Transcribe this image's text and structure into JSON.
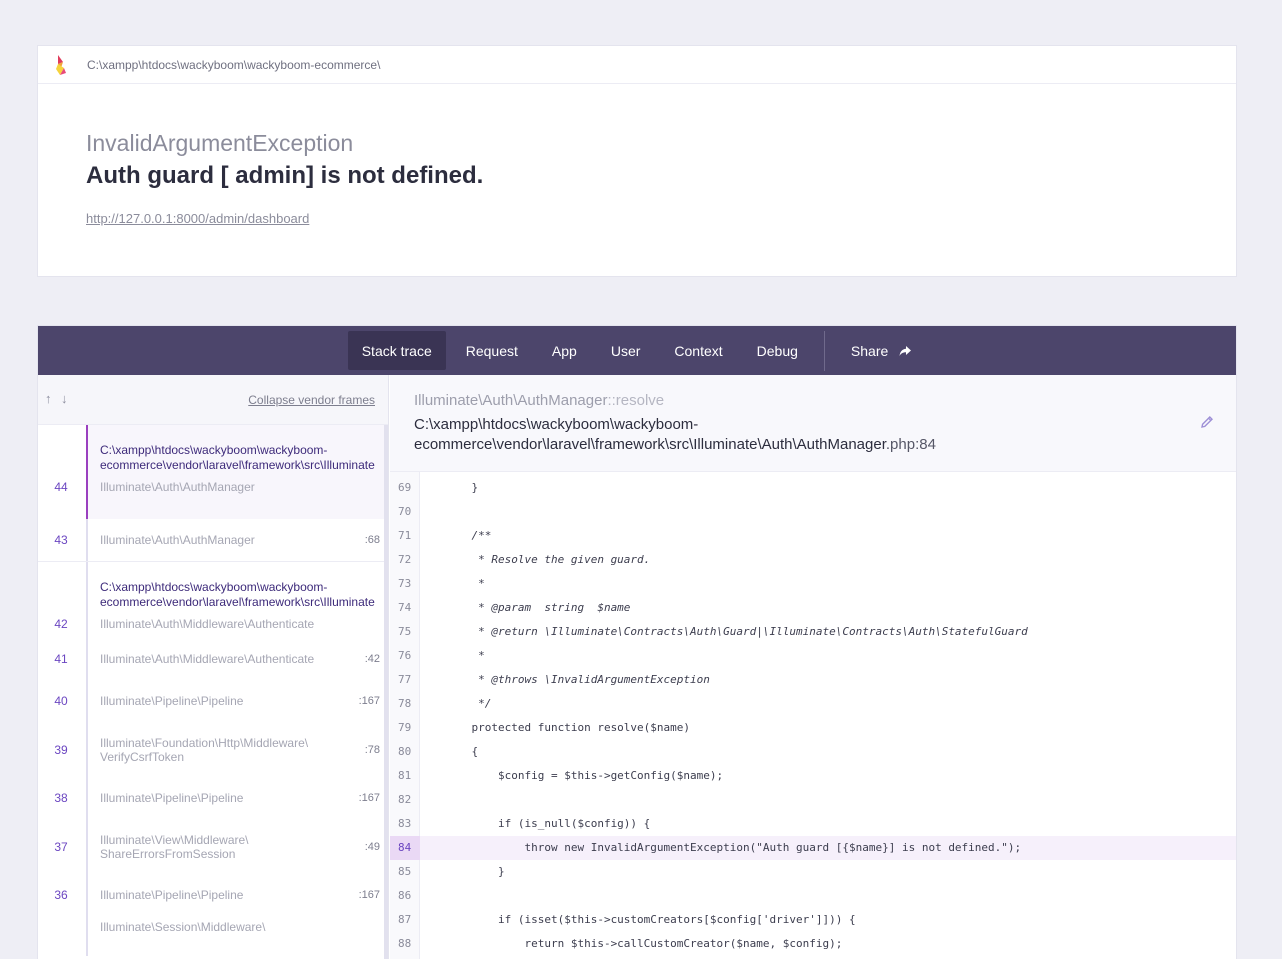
{
  "header": {
    "path": "C:\\xampp\\htdocs\\wackyboom\\wackyboom-ecommerce\\",
    "exception_class": "InvalidArgumentException",
    "exception_message": "Auth guard [ admin] is not defined.",
    "url": "http://127.0.0.1:8000/admin/dashboard"
  },
  "tabs": {
    "stack_trace": "Stack trace",
    "request": "Request",
    "app": "App",
    "user": "User",
    "context": "Context",
    "debug": "Debug",
    "share": "Share"
  },
  "stack": {
    "arrow_up": "↑",
    "arrow_down": "↓",
    "collapse_label": "Collapse vendor frames",
    "groups": [
      {
        "file": "C:\\xampp\\htdocs\\wackyboom\\wackyboom-ecommerce\\vendor\\laravel\\framework\\src\\Illuminate\\Auth\\AuthManager.php",
        "file_line1": "C:\\xampp\\htdocs\\wackyboom\\wackyboom-",
        "file_line2": "ecommerce\\vendor\\laravel\\framework\\src\\Illuminate",
        "frames": [
          {
            "num": "44",
            "class": "Illuminate\\Auth\\AuthManager",
            "line": ""
          },
          {
            "num": "43",
            "class": "Illuminate\\Auth\\AuthManager",
            "line": ":68"
          }
        ]
      },
      {
        "file_line1": "C:\\xampp\\htdocs\\wackyboom\\wackyboom-",
        "file_line2": "ecommerce\\vendor\\laravel\\framework\\src\\Illuminate",
        "frames": [
          {
            "num": "42",
            "class": "Illuminate\\Auth\\Middleware\\Authenticate",
            "line": ""
          },
          {
            "num": "41",
            "class": "Illuminate\\Auth\\Middleware\\Authenticate",
            "line": ":42"
          },
          {
            "num": "40",
            "class": "Illuminate\\Pipeline\\Pipeline",
            "line": ":167"
          },
          {
            "num": "39",
            "class_line1": "Illuminate\\Foundation\\Http\\Middleware\\",
            "class_line2": "VerifyCsrfToken",
            "line": ":78"
          },
          {
            "num": "38",
            "class": "Illuminate\\Pipeline\\Pipeline",
            "line": ":167"
          },
          {
            "num": "37",
            "class_line1": "Illuminate\\View\\Middleware\\",
            "class_line2": "ShareErrorsFromSession",
            "line": ":49"
          },
          {
            "num": "36",
            "class": "Illuminate\\Pipeline\\Pipeline",
            "line": ":167"
          },
          {
            "num": "35",
            "class_line1": "Illuminate\\Session\\Middleware\\",
            "class_line2": "",
            "line": ""
          }
        ]
      }
    ]
  },
  "code": {
    "class_name": "Illuminate\\Auth\\AuthManager",
    "method": "::resolve",
    "file_line1": "C:\\xampp\\htdocs\\wackyboom\\wackyboom-",
    "file_line2": "ecommerce\\vendor\\laravel\\framework\\src\\Illuminate\\Auth\\AuthManager",
    "file_suffix": ".php:84",
    "highlight_line": 84,
    "lines": [
      {
        "n": "69",
        "text": "    }"
      },
      {
        "n": "70",
        "text": ""
      },
      {
        "n": "71",
        "text": "    /**"
      },
      {
        "n": "72",
        "text": "     * Resolve the given guard."
      },
      {
        "n": "73",
        "text": "     *"
      },
      {
        "n": "74",
        "text": "     * @param  string  $name"
      },
      {
        "n": "75",
        "text": "     * @return \\Illuminate\\Contracts\\Auth\\Guard|\\Illuminate\\Contracts\\Auth\\StatefulGuard"
      },
      {
        "n": "76",
        "text": "     *"
      },
      {
        "n": "77",
        "text": "     * @throws \\InvalidArgumentException"
      },
      {
        "n": "78",
        "text": "     */"
      },
      {
        "n": "79",
        "text": "    protected function resolve($name)"
      },
      {
        "n": "80",
        "text": "    {"
      },
      {
        "n": "81",
        "text": "        $config = $this->getConfig($name);"
      },
      {
        "n": "82",
        "text": ""
      },
      {
        "n": "83",
        "text": "        if (is_null($config)) {"
      },
      {
        "n": "84",
        "text": "            throw new InvalidArgumentException(\"Auth guard [{$name}] is not defined.\");"
      },
      {
        "n": "85",
        "text": "        }"
      },
      {
        "n": "86",
        "text": ""
      },
      {
        "n": "87",
        "text": "        if (isset($this->customCreators[$config['driver']])) {"
      },
      {
        "n": "88",
        "text": "            return $this->callCustomCreator($name, $config);"
      }
    ]
  }
}
